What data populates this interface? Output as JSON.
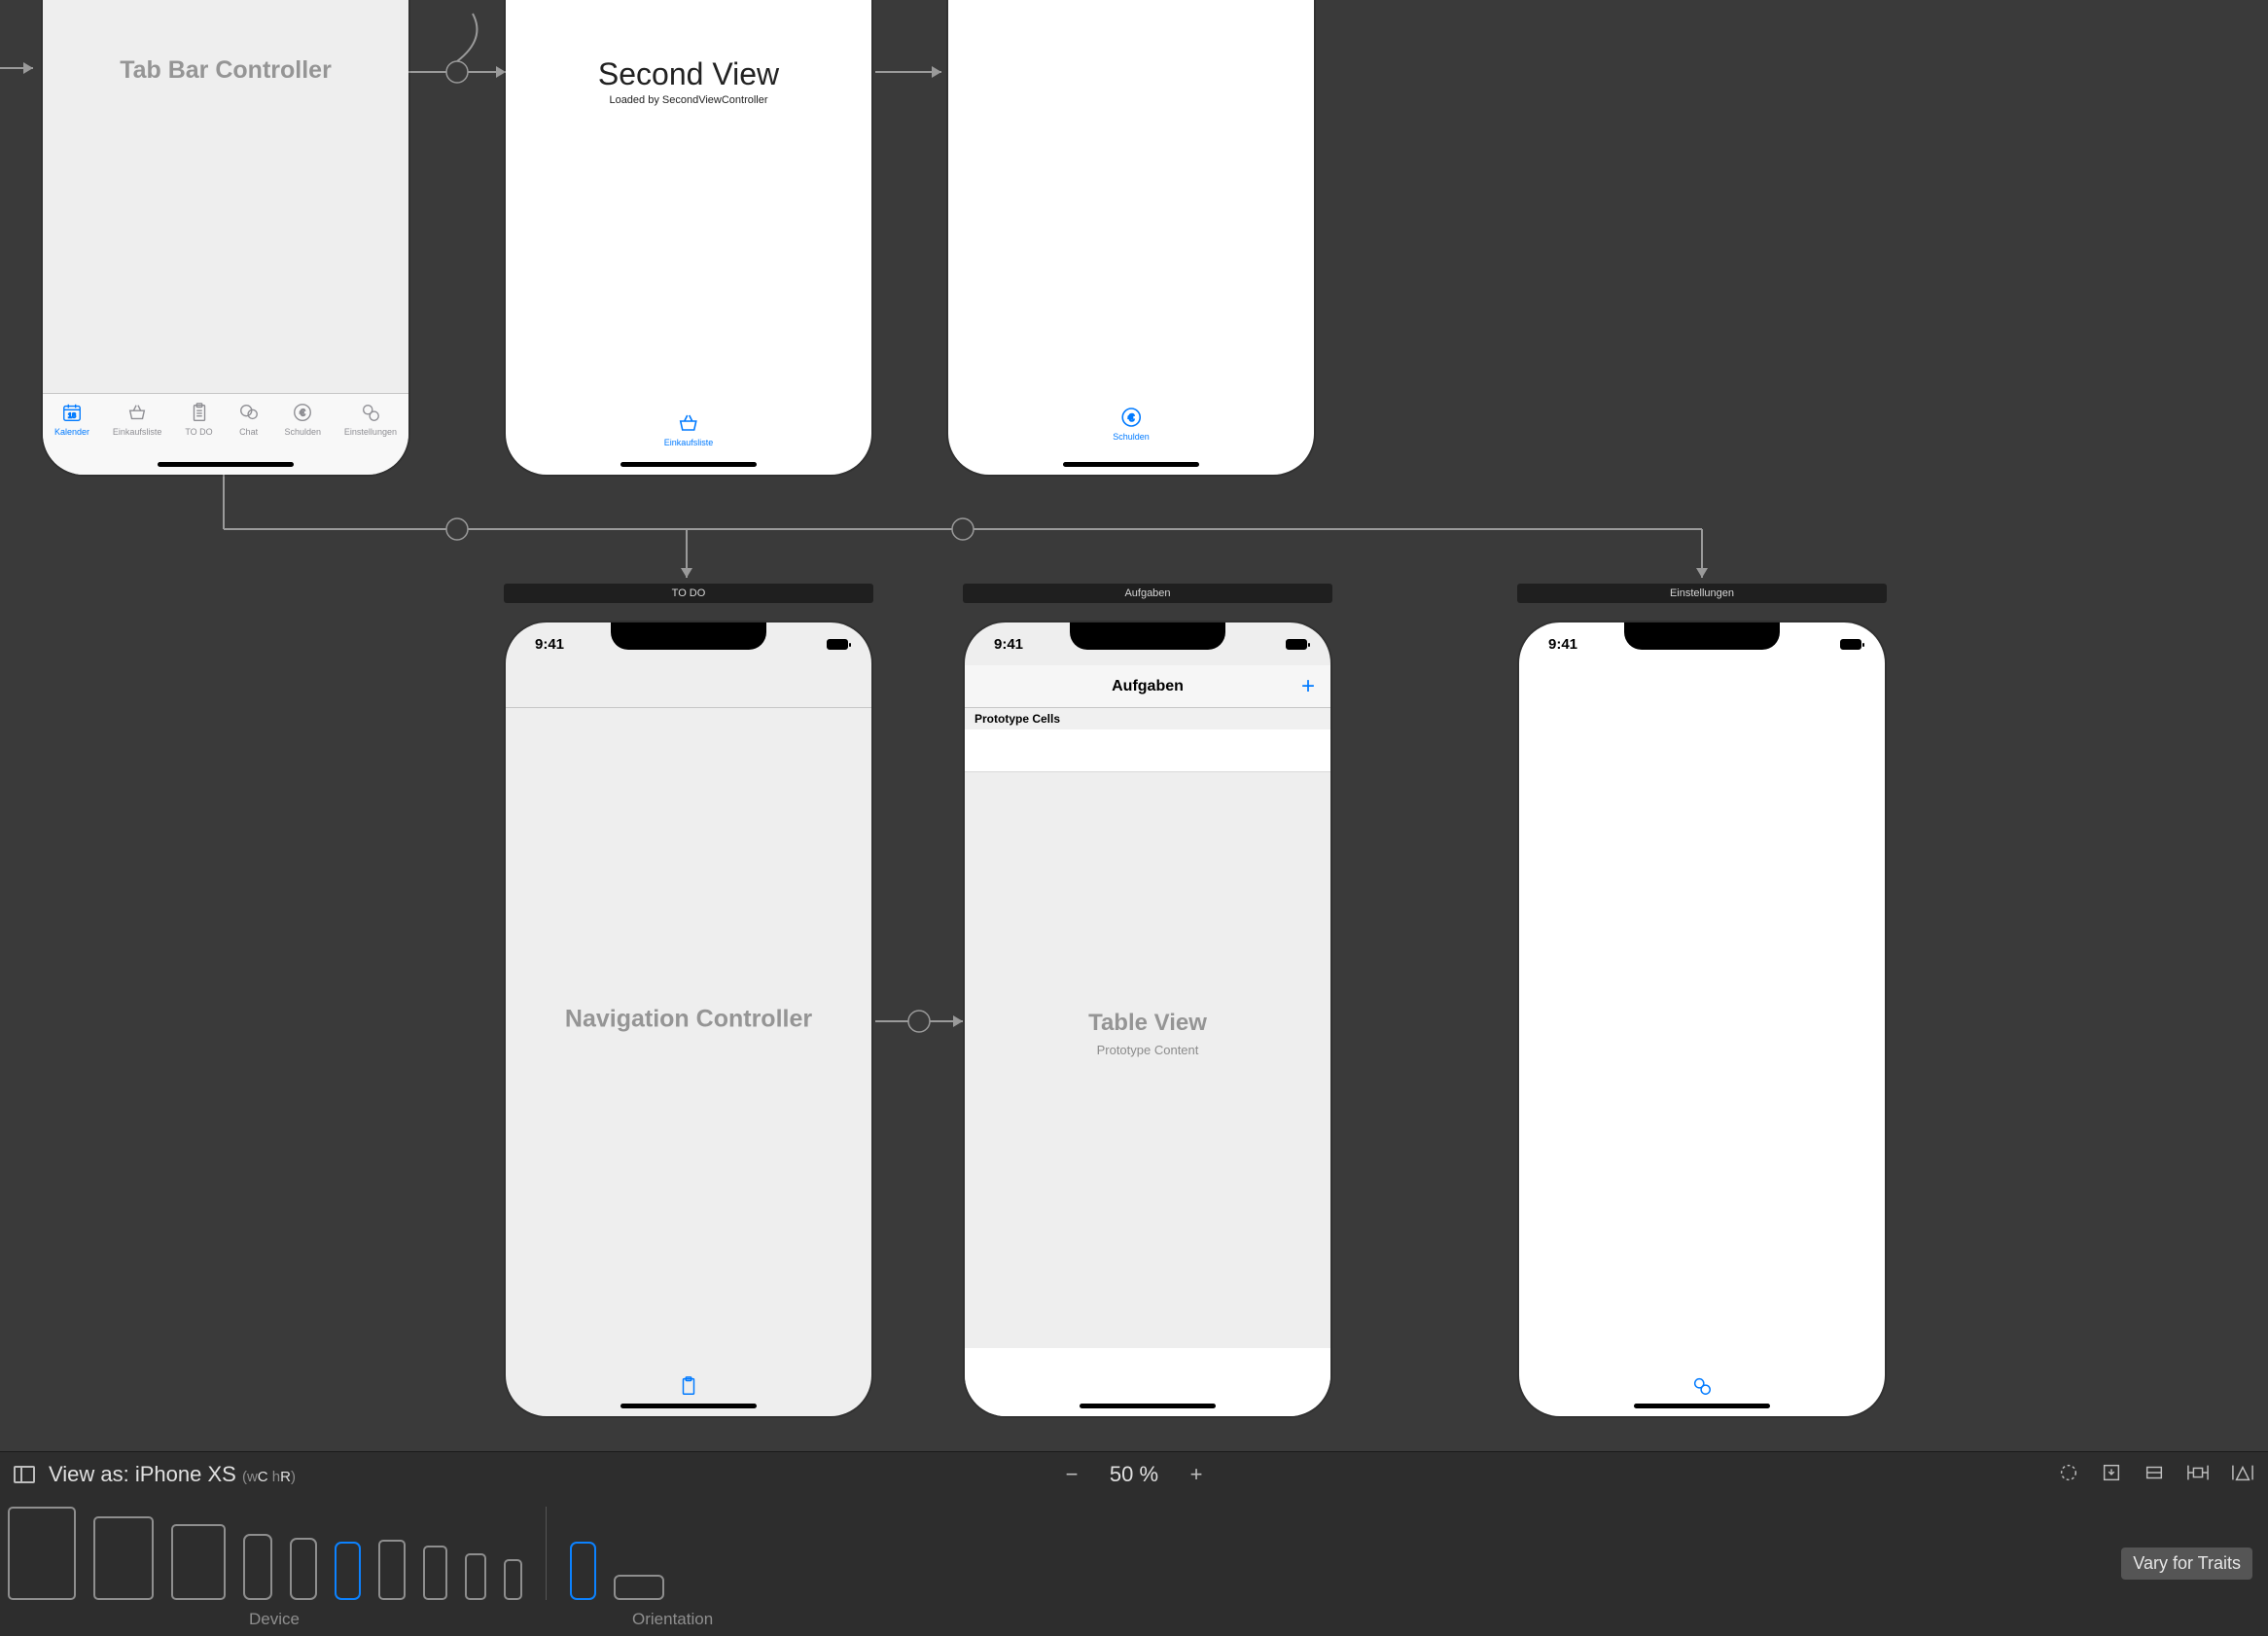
{
  "scenes": {
    "tabbar_controller": {
      "label": "Tab Bar Controller"
    },
    "second_view": {
      "title": "Second View",
      "subtitle": "Loaded by SecondViewController"
    },
    "nav_controller": {
      "scene_title": "TO DO",
      "label": "Navigation Controller"
    },
    "aufgaben": {
      "scene_title": "Aufgaben",
      "nav_title": "Aufgaben",
      "proto_header": "Prototype Cells",
      "table_label": "Table View",
      "table_sub": "Prototype Content"
    },
    "einstellungen": {
      "scene_title": "Einstellungen"
    }
  },
  "status": {
    "time": "9:41"
  },
  "tabs": [
    {
      "label": "Kalender"
    },
    {
      "label": "Einkaufsliste"
    },
    {
      "label": "TO DO"
    },
    {
      "label": "Chat"
    },
    {
      "label": "Schulden"
    },
    {
      "label": "Einstellungen"
    }
  ],
  "single_tabs": {
    "einkauf": "Einkaufsliste",
    "schulden": "Schulden"
  },
  "bottombar": {
    "viewas_prefix": "View as: ",
    "viewas_device": "iPhone XS",
    "zoom": "50 %",
    "device_label": "Device",
    "orientation_label": "Orientation",
    "vary": "Vary for Traits"
  }
}
